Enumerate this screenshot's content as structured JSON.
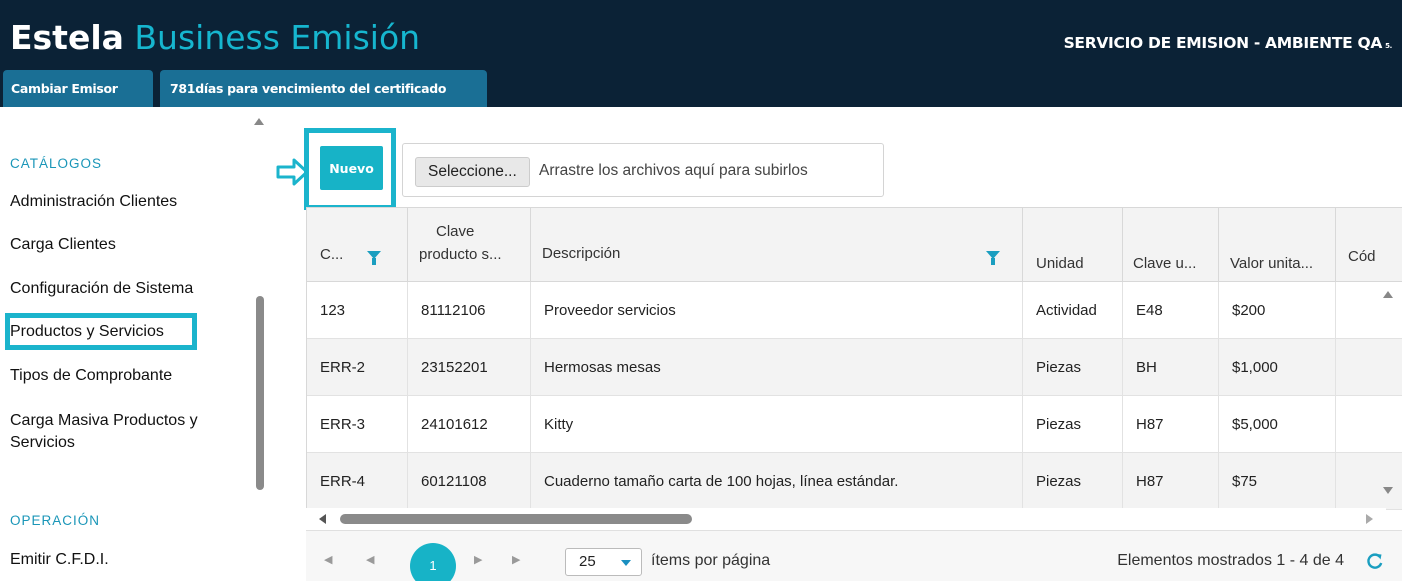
{
  "header": {
    "brand_bold": "Estela",
    "brand_light": "Business Emisión",
    "environment": "SERVICIO DE EMISION - AMBIENTE QA",
    "environment_suffix": "5.",
    "tabs": [
      {
        "label": "Cambiar Emisor"
      },
      {
        "label": "781días para vencimiento del certificado"
      }
    ]
  },
  "sidebar": {
    "sections": [
      {
        "title": "CATÁLOGOS",
        "items": [
          {
            "label": "Administración Clientes"
          },
          {
            "label": "Carga Clientes"
          },
          {
            "label": "Configuración de Sistema"
          },
          {
            "label": "Productos y Servicios"
          },
          {
            "label": "Tipos de Comprobante"
          },
          {
            "label": "Carga Masiva Productos y Servicios"
          }
        ]
      },
      {
        "title": "OPERACIÓN",
        "items": [
          {
            "label": "Emitir C.F.D.I."
          }
        ]
      }
    ]
  },
  "toolbar": {
    "new_label": "Nuevo",
    "upload_button": "Seleccione...",
    "upload_hint": "Arrastre los archivos aquí para subirlos"
  },
  "grid": {
    "columns": [
      "C...",
      "Clave producto s...",
      "Descripción",
      "Unidad",
      "Clave u...",
      "Valor unita...",
      "Cód"
    ],
    "columns_line1": [
      "",
      "Clave",
      "",
      "",
      "",
      "",
      ""
    ],
    "columns_line2": [
      "",
      "producto s...",
      "",
      "",
      "",
      "",
      ""
    ],
    "rows": [
      [
        "123",
        "81112106",
        "Proveedor servicios",
        "Actividad",
        "E48",
        "$200",
        ""
      ],
      [
        "ERR-2",
        "23152201",
        "Hermosas mesas",
        "Piezas",
        "BH",
        "$1,000",
        ""
      ],
      [
        "ERR-3",
        "24101612",
        "Kitty",
        "Piezas",
        "H87",
        "$5,000",
        ""
      ],
      [
        "ERR-4",
        "60121108",
        "Cuaderno tamaño carta de 100 hojas, línea estándar.",
        "Piezas",
        "H87",
        "$75",
        ""
      ]
    ]
  },
  "pager": {
    "current_page": "1",
    "page_size": "25",
    "page_size_label": "ítems por página",
    "info": "Elementos mostrados 1 - 4 de 4"
  },
  "colors": {
    "header_bg": "#0b2236",
    "accent": "#17b3c7",
    "tab_bg": "#1a6f95",
    "filter_icon": "#1a9ec0"
  },
  "icons": {
    "pointer_arrow": "arrow-right-outline-icon",
    "filter": "filter-funnel-icon",
    "refresh": "refresh-icon"
  }
}
